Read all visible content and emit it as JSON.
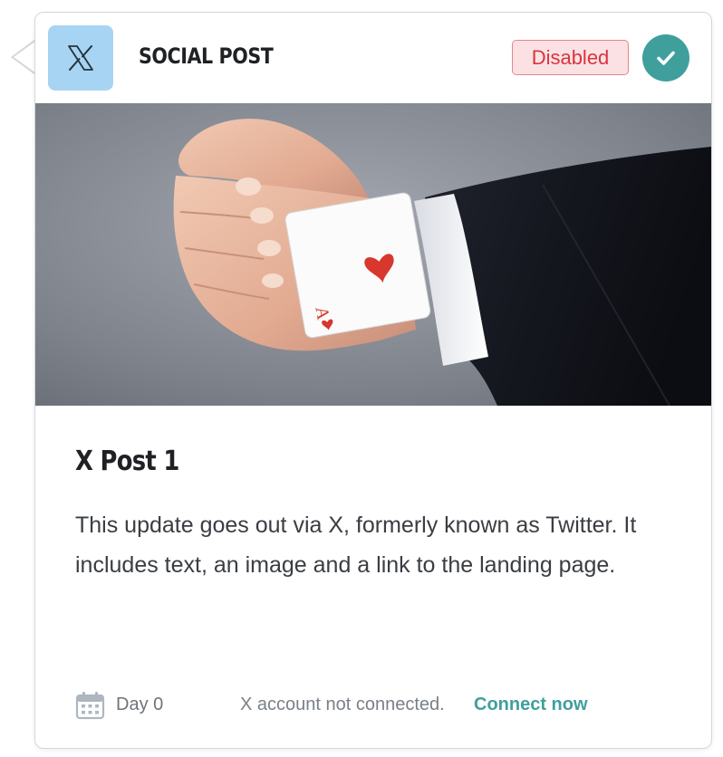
{
  "header": {
    "logo_icon": "x-logo-icon",
    "logo_glyph": "𝕏",
    "title": "SOCIAL POST",
    "status_badge": "Disabled",
    "status_icon": "checkmark-icon"
  },
  "post": {
    "image_description_icon": "post-image",
    "title": "X Post 1",
    "body": "This update goes out via X, formerly known as Twitter. It includes text, an image and a link to the landing page."
  },
  "footer": {
    "calendar_icon": "calendar-icon",
    "day_label": "Day 0",
    "connection_status": "X account not connected.",
    "connect_link": "Connect now"
  },
  "colors": {
    "logo_tile_bg": "#a7d4f3",
    "badge_bg": "#fbe1e3",
    "badge_border": "#e4868c",
    "badge_text": "#d9343f",
    "accent_teal": "#3f9f9d",
    "title_text": "#1f2125",
    "body_text": "#3a3d42",
    "muted_text": "#7a8087"
  }
}
